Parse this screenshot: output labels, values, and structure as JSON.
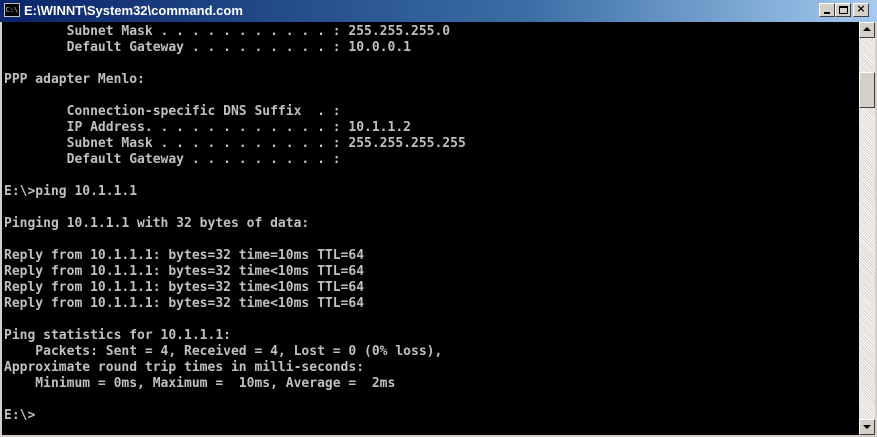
{
  "window": {
    "title": "E:\\WINNT\\System32\\command.com",
    "icon": "console-icon",
    "icon_text": "C:\\",
    "close_glyph": "×"
  },
  "colors": {
    "console_bg": "#000000",
    "console_fg": "#c0c0c0",
    "titlebar_start": "#0a246a",
    "titlebar_end": "#a6caf0"
  },
  "console": {
    "lines": [
      "        Subnet Mask . . . . . . . . . . . : 255.255.255.0",
      "        Default Gateway . . . . . . . . . : 10.0.0.1",
      "",
      "PPP adapter Menlo:",
      "",
      "        Connection-specific DNS Suffix  . :",
      "        IP Address. . . . . . . . . . . . : 10.1.1.2",
      "        Subnet Mask . . . . . . . . . . . : 255.255.255.255",
      "        Default Gateway . . . . . . . . . :",
      "",
      "E:\\>ping 10.1.1.1",
      "",
      "Pinging 10.1.1.1 with 32 bytes of data:",
      "",
      "Reply from 10.1.1.1: bytes=32 time=10ms TTL=64",
      "Reply from 10.1.1.1: bytes=32 time<10ms TTL=64",
      "Reply from 10.1.1.1: bytes=32 time<10ms TTL=64",
      "Reply from 10.1.1.1: bytes=32 time<10ms TTL=64",
      "",
      "Ping statistics for 10.1.1.1:",
      "    Packets: Sent = 4, Received = 4, Lost = 0 (0% loss),",
      "Approximate round trip times in milli-seconds:",
      "    Minimum = 0ms, Maximum =  10ms, Average =  2ms",
      "",
      "E:\\>"
    ]
  }
}
